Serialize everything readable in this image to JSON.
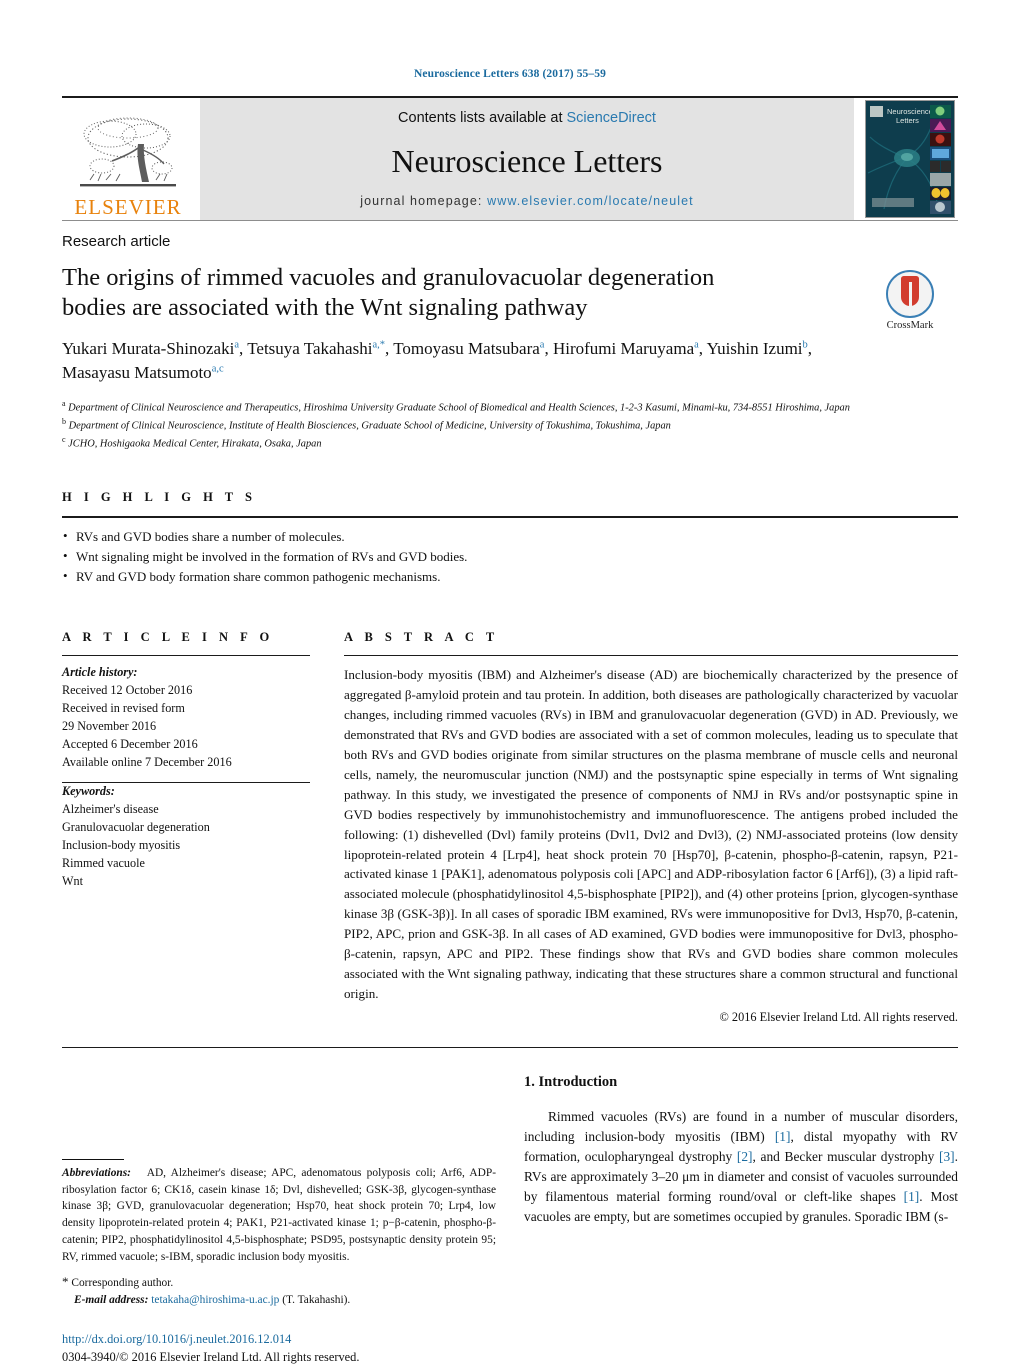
{
  "running_head": "Neuroscience Letters 638 (2017) 55–59",
  "masthead": {
    "publisher_name": "ELSEVIER",
    "contents_prefix": "Contents lists available at ",
    "contents_link": "ScienceDirect",
    "journal_name": "Neuroscience Letters",
    "homepage_prefix": "journal homepage: ",
    "homepage_url": "www.elsevier.com/locate/neulet",
    "cover_title_line1": "Neuroscience",
    "cover_title_line2": "Letters",
    "link_color": "#2a7ab0",
    "elsevier_orange": "#E8820C"
  },
  "article": {
    "type": "Research article",
    "title": "The origins of rimmed vacuoles and granulovacuolar degeneration bodies are associated with the Wnt signaling pathway",
    "crossmark_label": "CrossMark",
    "authors_line1": "Yukari Murata-Shinozaki",
    "authors_line1_sup": "a",
    "authors": [
      {
        "name": "Yukari Murata-Shinozaki",
        "sup": "a",
        "sep": ", "
      },
      {
        "name": "Tetsuya Takahashi",
        "sup": "a,*",
        "sep": ", "
      },
      {
        "name": "Tomoyasu Matsubara",
        "sup": "a",
        "sep": ","
      },
      {
        "name": "Hirofumi Maruyama",
        "sup": "a",
        "sep": ", "
      },
      {
        "name": "Yuishin Izumi",
        "sup": "b",
        "sep": ", "
      },
      {
        "name": "Masayasu Matsumoto",
        "sup": "a,c",
        "sep": ""
      }
    ],
    "affiliations": [
      {
        "marker": "a",
        "text": "Department of Clinical Neuroscience and Therapeutics, Hiroshima University Graduate School of Biomedical and Health Sciences, 1-2-3 Kasumi, Minami-ku, 734-8551 Hiroshima, Japan"
      },
      {
        "marker": "b",
        "text": "Department of Clinical Neuroscience, Institute of Health Biosciences, Graduate School of Medicine, University of Tokushima, Tokushima, Japan"
      },
      {
        "marker": "c",
        "text": "JCHO, Hoshigaoka Medical Center, Hirakata, Osaka, Japan"
      }
    ]
  },
  "highlights": {
    "heading": "H I G H L I G H T S",
    "items": [
      "RVs and GVD bodies share a number of molecules.",
      "Wnt signaling might be involved in the formation of RVs and GVD bodies.",
      "RV and GVD body formation share common pathogenic mechanisms."
    ]
  },
  "article_info": {
    "heading": "A R T I C L E   I N F O",
    "history_label": "Article history:",
    "history": [
      "Received 12 October 2016",
      "Received in revised form",
      "29 November 2016",
      "Accepted 6 December 2016",
      "Available online 7 December 2016"
    ],
    "keywords_label": "Keywords:",
    "keywords": [
      "Alzheimer's disease",
      "Granulovacuolar degeneration",
      "Inclusion-body myositis",
      "Rimmed vacuole",
      "Wnt"
    ]
  },
  "abstract": {
    "heading": "A B S T R A C T",
    "text": "Inclusion-body myositis (IBM) and Alzheimer's disease (AD) are biochemically characterized by the presence of aggregated β-amyloid protein and tau protein. In addition, both diseases are pathologically characterized by vacuolar changes, including rimmed vacuoles (RVs) in IBM and granulovacuolar degeneration (GVD) in AD. Previously, we demonstrated that RVs and GVD bodies are associated with a set of common molecules, leading us to speculate that both RVs and GVD bodies originate from similar structures on the plasma membrane of muscle cells and neuronal cells, namely, the neuromuscular junction (NMJ) and the postsynaptic spine especially in terms of Wnt signaling pathway. In this study, we investigated the presence of components of NMJ in RVs and/or postsynaptic spine in GVD bodies respectively by immunohistochemistry and immunofluorescence. The antigens probed included the following: (1) dishevelled (Dvl) family proteins (Dvl1, Dvl2 and Dvl3), (2) NMJ-associated proteins (low density lipoprotein-related protein 4 [Lrp4], heat shock protein 70 [Hsp70], β-catenin, phospho-β-catenin, rapsyn, P21-activated kinase 1 [PAK1], adenomatous polyposis coli [APC] and ADP-ribosylation factor 6 [Arf6]), (3) a lipid raft-associated molecule (phosphatidylinositol 4,5-bisphosphate [PIP2]), and (4) other proteins [prion, glycogen-synthase kinase 3β (GSK-3β)]. In all cases of sporadic IBM examined, RVs were immunopositive for Dvl3, Hsp70, β-catenin, PIP2, APC, prion and GSK-3β. In all cases of AD examined, GVD bodies were immunopositive for Dvl3, phospho-β-catenin, rapsyn, APC and PIP2. These findings show that RVs and GVD bodies share common molecules associated with the Wnt signaling pathway, indicating that these structures share a common structural and functional origin.",
    "copyright": "© 2016 Elsevier Ireland Ltd. All rights reserved."
  },
  "footnotes": {
    "abbrev_label": "Abbreviations:",
    "abbrev_text": "AD, Alzheimer's disease; APC, adenomatous polyposis coli; Arf6, ADP-ribosylation factor 6; CK1δ, casein kinase 1δ; Dvl, dishevelled; GSK-3β, glycogen-synthase kinase 3β; GVD, granulovacuolar degeneration; Hsp70, heat shock protein 70; Lrp4, low density lipoprotein-related protein 4; PAK1, P21-activated kinase 1; p−β-catenin, phospho-β-catenin; PIP2, phosphatidylinositol 4,5-bisphosphate; PSD95, postsynaptic density protein 95; RV, rimmed vacuole; s-IBM, sporadic inclusion body myositis.",
    "corresponding": "Corresponding author.",
    "email_label": "E-mail address:",
    "email": "tetakaha@hiroshima-u.ac.jp",
    "email_suffix": "(T. Takahashi).",
    "doi_url": "http://dx.doi.org/10.1016/j.neulet.2016.12.014",
    "issn_line": "0304-3940/© 2016 Elsevier Ireland Ltd. All rights reserved."
  },
  "introduction": {
    "heading": "1.  Introduction",
    "paragraph_parts": [
      {
        "t": "Rimmed vacuoles (RVs) are found in a number of muscular disorders, including inclusion-body myositis (IBM) ",
        "ref": false
      },
      {
        "t": "[1]",
        "ref": true
      },
      {
        "t": ", distal myopathy with RV formation, oculopharyngeal dystrophy ",
        "ref": false
      },
      {
        "t": "[2]",
        "ref": true
      },
      {
        "t": ", and Becker muscular dystrophy ",
        "ref": false
      },
      {
        "t": "[3]",
        "ref": true
      },
      {
        "t": ". RVs are approximately 3–20 μm in diameter and consist of vacuoles surrounded by filamentous material forming round/oval or cleft-like shapes ",
        "ref": false
      },
      {
        "t": "[1]",
        "ref": true
      },
      {
        "t": ". Most vacuoles are empty, but are sometimes occupied by granules. Sporadic IBM (s-",
        "ref": false
      }
    ]
  }
}
